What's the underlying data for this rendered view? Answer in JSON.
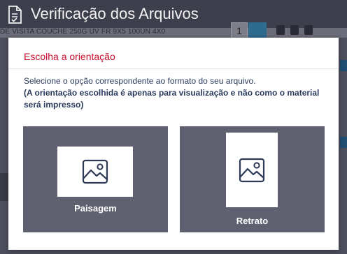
{
  "background": {
    "page_title": "Verificação dos Arquivos",
    "product_line": "DE VISITA COUCHE 250G UV FR 9X5 100UN 4X0",
    "quantity": "1"
  },
  "modal": {
    "title": "Escolha a orientação",
    "instruction": "Selecione o opção correspondente ao formato do seu arquivo.",
    "note": "(A orientação escolhida é apenas para visualização e não como o material será impresso)",
    "options": [
      {
        "label": "Paisagem",
        "icon": "image-icon"
      },
      {
        "label": "Retrato",
        "icon": "image-icon"
      }
    ]
  },
  "colors": {
    "title_red": "#c8102e",
    "option_bg": "#5f6070",
    "overlay": "#4e4f5e"
  }
}
